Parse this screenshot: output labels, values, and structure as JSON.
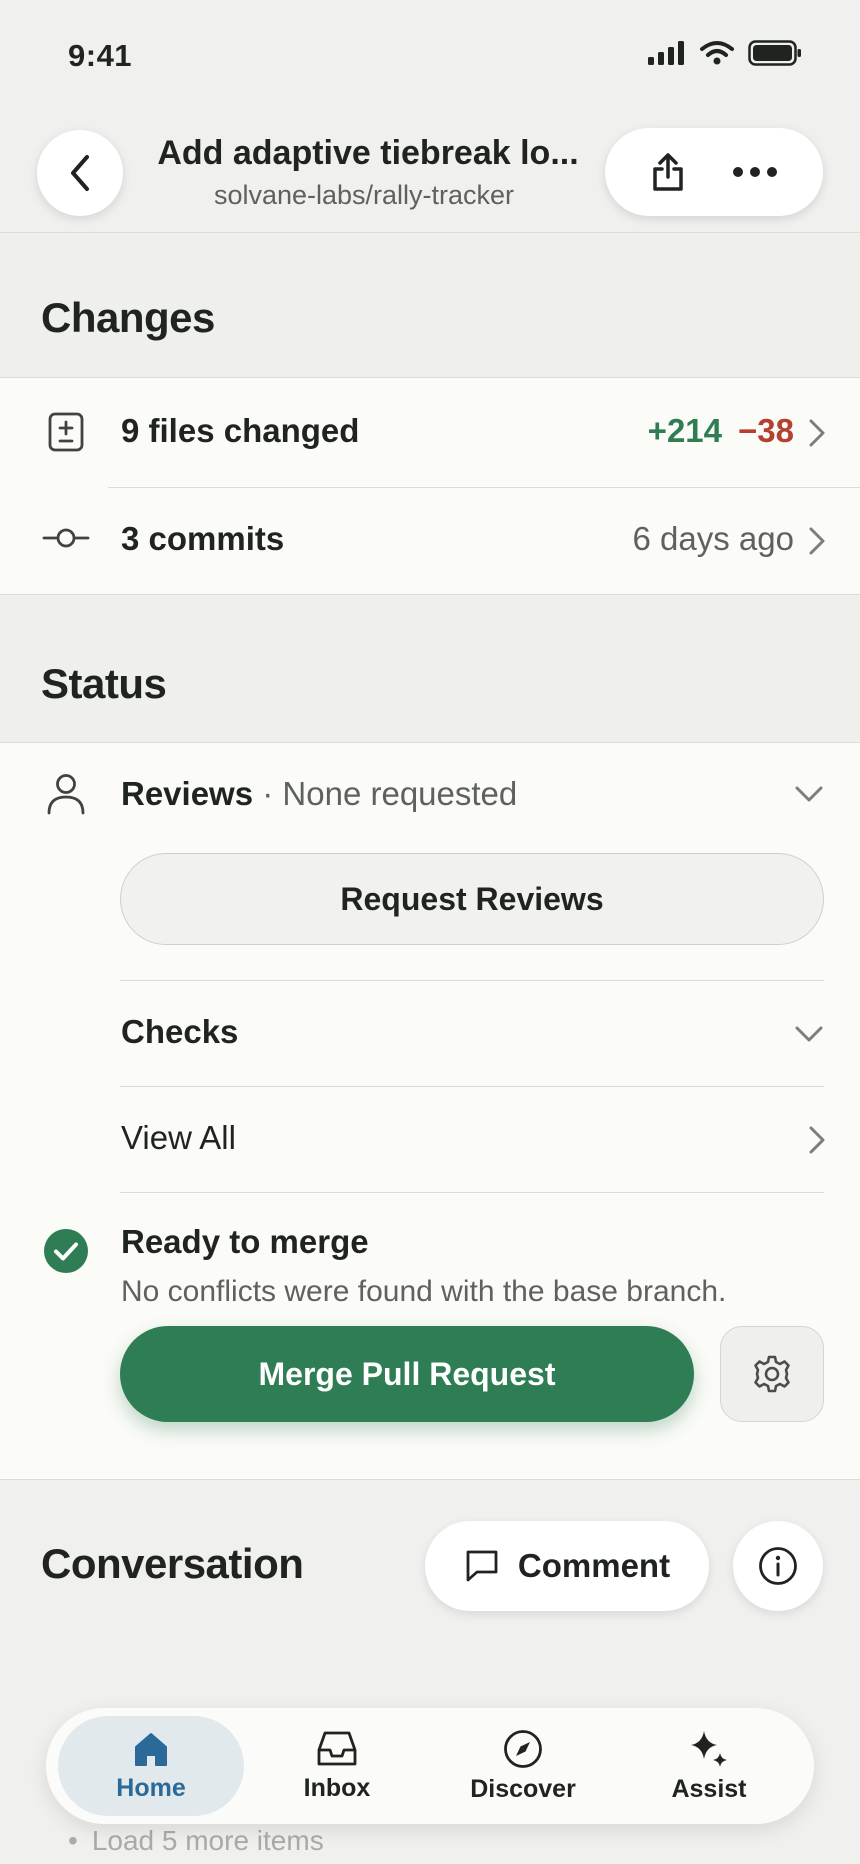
{
  "status_bar": {
    "time": "9:41"
  },
  "header": {
    "title": "Add adaptive tiebreak lo...",
    "subtitle": "solvane-labs/rally-tracker"
  },
  "changes": {
    "section_title": "Changes",
    "files_label": "9 files changed",
    "additions": "+214",
    "deletions": "−38",
    "commits_label": "3 commits",
    "commits_time": "6 days ago"
  },
  "status": {
    "section_title": "Status",
    "reviews_label": "Reviews",
    "reviews_state": " · None requested",
    "request_reviews_button": "Request Reviews",
    "checks_label": "Checks",
    "view_all_label": "View All",
    "ready_title": "Ready to merge",
    "ready_desc": "No conflicts were found with the base branch.",
    "merge_button": "Merge Pull Request"
  },
  "conversation": {
    "section_title": "Conversation",
    "comment_button": "Comment",
    "load_more": "Load 5 more items"
  },
  "tab_bar": {
    "tabs": [
      {
        "label": "Home",
        "icon": "home-icon",
        "active": true
      },
      {
        "label": "Inbox",
        "icon": "inbox-icon",
        "active": false
      },
      {
        "label": "Discover",
        "icon": "compass-icon",
        "active": false
      },
      {
        "label": "Assist",
        "icon": "sparkle-icon",
        "active": false
      }
    ]
  },
  "colors": {
    "accent_green": "#2e7d55",
    "deletion_red": "#b4402f",
    "active_tab_blue": "#2b6a98"
  }
}
